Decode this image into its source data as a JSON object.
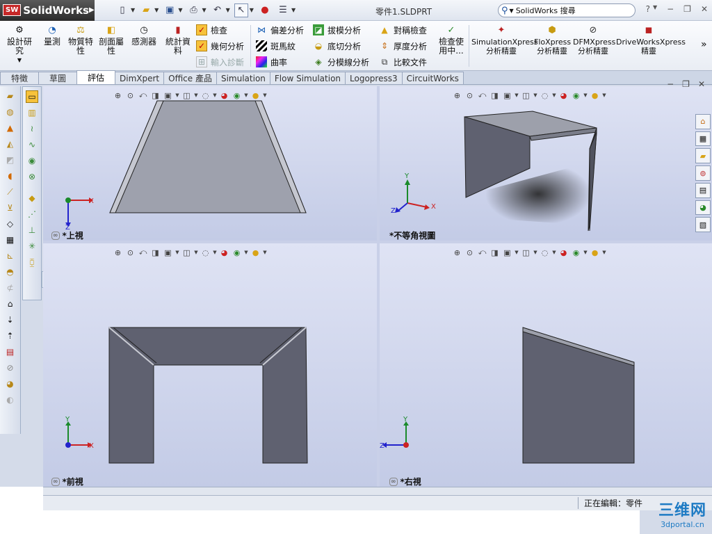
{
  "app": {
    "name": "SolidWorks",
    "badge": "SW",
    "document_title": "零件1.SLDPRT"
  },
  "search": {
    "placeholder": "SolidWorks 搜尋"
  },
  "ribbon": {
    "big_left": [
      {
        "label": "設計研究",
        "icon": "design-study-icon"
      },
      {
        "label": "量測",
        "icon": "measure-icon"
      },
      {
        "label": "物質特性",
        "icon": "mass-properties-icon"
      },
      {
        "label": "剖面屬性",
        "icon": "section-properties-icon"
      },
      {
        "label": "感測器",
        "icon": "sensor-icon"
      },
      {
        "label": "統計資料",
        "icon": "statistics-icon"
      }
    ],
    "check_group": [
      {
        "label": "檢查",
        "enabled": true
      },
      {
        "label": "幾何分析",
        "enabled": true
      },
      {
        "label": "輸入診斷",
        "enabled": false
      }
    ],
    "analysis_col1": [
      {
        "label": "偏差分析"
      },
      {
        "label": "斑馬紋"
      },
      {
        "label": "曲率"
      }
    ],
    "analysis_col2": [
      {
        "label": "拔模分析"
      },
      {
        "label": "底切分析"
      },
      {
        "label": "分模線分析"
      }
    ],
    "analysis_col3": [
      {
        "label": "對稱檢查"
      },
      {
        "label": "厚度分析"
      },
      {
        "label": "比較文件"
      }
    ],
    "big_right": [
      {
        "label": "檢查使用中..."
      },
      {
        "label": "SimulationXpress 分析精靈"
      },
      {
        "label": "FloXpress 分析精靈"
      },
      {
        "label": "DFMXpress 分析精靈"
      },
      {
        "label": "DriveWorksXpress 精靈"
      }
    ],
    "more": "»"
  },
  "tabs": [
    {
      "label": "特徵",
      "active": false
    },
    {
      "label": "草圖",
      "active": false
    },
    {
      "label": "評估",
      "active": true
    },
    {
      "label": "DimXpert",
      "active": false
    },
    {
      "label": "Office 產品",
      "active": false
    },
    {
      "label": "Simulation",
      "active": false
    },
    {
      "label": "Flow Simulation",
      "active": false
    },
    {
      "label": "Logopress3",
      "active": false
    },
    {
      "label": "CircuitWorks",
      "active": false
    }
  ],
  "viewports": [
    {
      "label": "*上視",
      "axes": [
        "X",
        "Z"
      ]
    },
    {
      "label": "*不等角視圖",
      "axes": [
        "Y",
        "Z",
        "X"
      ]
    },
    {
      "label": "*前視",
      "axes": [
        "Y",
        "X"
      ]
    },
    {
      "label": "*右視",
      "axes": [
        "Y",
        "Z"
      ]
    }
  ],
  "status": {
    "editing": "正在編輯：零件"
  },
  "watermark": {
    "line1": "三维网",
    "line2": "3dportal.cn"
  },
  "colors": {
    "accent": "#1e7bc4",
    "brand": "#c62828",
    "model_face": "#5f6170",
    "model_top": "#9da0ab"
  }
}
